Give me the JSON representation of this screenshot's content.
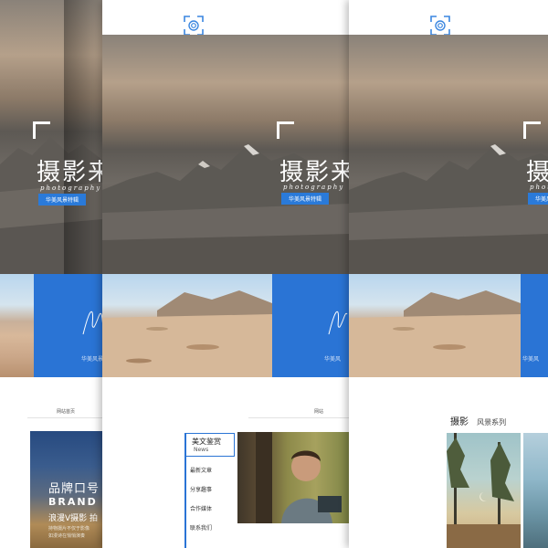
{
  "hero": {
    "title_visible_1": "摄影来",
    "title_visible_2": "摄影来源",
    "title_visible_3": "摄影",
    "script": "photography",
    "script_visible_3": "photogr",
    "button": "华美风景特辑",
    "button_visible_3": "华美风"
  },
  "feature": {
    "blue_subtitle_1": "华美风景特辑",
    "blue_subtitle_2": "华美风",
    "blue_subtitle_3": "华美风"
  },
  "nav": {
    "home": "网站首页",
    "home_partial": "网站"
  },
  "brand": {
    "line1": "品牌口号",
    "line2": "BRAND SL",
    "line3": "浪漫V摄影  拍",
    "line4": "持物摄片不仅于影像",
    "line5": "如漫诗在悄悄演奏"
  },
  "side_menu": {
    "head_zh": "美文鉴赏",
    "head_en": "News",
    "items": [
      "最新文章",
      "分享趣事",
      "合作媒体",
      "联系我们"
    ]
  },
  "series": {
    "title_main": "摄影",
    "title_sub": "风景系列"
  },
  "colors": {
    "accent": "#2a74d5",
    "logo": "#3a86e0"
  }
}
